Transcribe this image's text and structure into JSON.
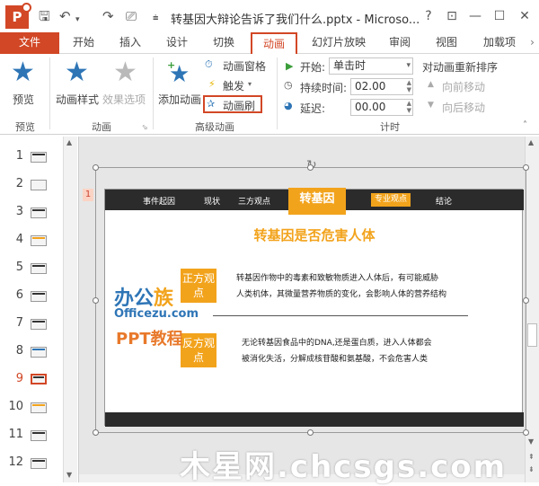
{
  "titlebar": {
    "doc_title": "转基因大辩论告诉了我们什么.pptx - Microso...",
    "help": "?",
    "restore": "⊡",
    "minimize": "—",
    "maximize": "☐",
    "close": "✕"
  },
  "tabs": [
    "文件",
    "开始",
    "插入",
    "设计",
    "切换",
    "动画",
    "幻灯片放映",
    "审阅",
    "视图",
    "加载项"
  ],
  "ribbon": {
    "preview_group": {
      "button": "预览",
      "label": "预览"
    },
    "animation_group": {
      "style_button": "动画样式",
      "effect_button": "效果选项",
      "label": "动画"
    },
    "advanced_group": {
      "add_button": "添加动画",
      "pane_button": "动画窗格",
      "trigger_button": "触发",
      "painter_button": "动画刷",
      "label": "高级动画"
    },
    "timing_group": {
      "start_label": "开始:",
      "start_value": "单击时",
      "duration_label": "持续时间:",
      "duration_value": "02.00",
      "delay_label": "延迟:",
      "delay_value": "00.00",
      "reorder_title": "对动画重新排序",
      "move_earlier": "向前移动",
      "move_later": "向后移动",
      "label": "计时"
    }
  },
  "thumbnails": [
    "1",
    "2",
    "3",
    "4",
    "5",
    "6",
    "7",
    "8",
    "9",
    "10",
    "11",
    "12"
  ],
  "active_slide": "9",
  "slide": {
    "number": "1",
    "nav": [
      "事件起因",
      "现状",
      "三方观点",
      "转基因",
      "专业观点",
      "结论"
    ],
    "title": "转基因是否危害人体",
    "box1": "正方观点",
    "box2": "反方观点",
    "text1_line1": "转基因作物中的毒素和致敏物质进入人体后，有可能威胁",
    "text1_line2": "人类机体，其微量营养物质的变化，会影响人体的营养结构",
    "text2_line1": "无论转基因食品中的DNA,还是蛋白质，进入人体都会",
    "text2_line2": "被消化失活，分解成核苷酸和氨基酸，不会危害人类",
    "logo_line1a": "办公",
    "logo_line1b": "族",
    "logo_line2": "Officezu.com",
    "logo_line3": "PPT教程"
  },
  "watermark": "木星网.chcsgs.com",
  "colors": {
    "accent": "#d24726",
    "orange": "#f2a31c",
    "blue": "#2e75b6"
  }
}
